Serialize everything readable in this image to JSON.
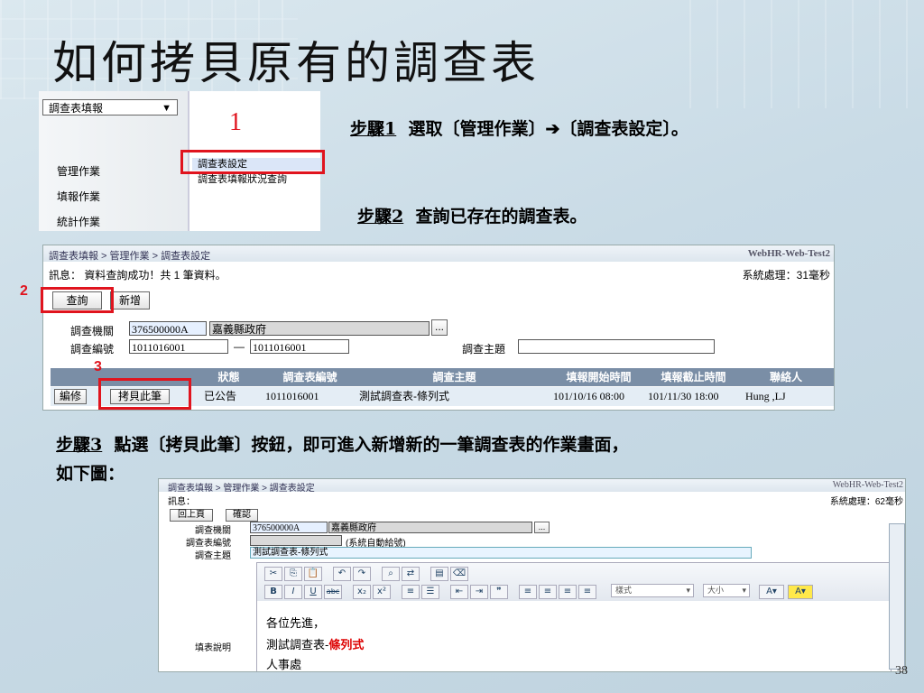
{
  "title": "如何拷貝原有的調查表",
  "menu": {
    "dropdown": "調查表填報",
    "items": [
      "管理作業",
      "填報作業",
      "統計作業"
    ],
    "submenu": [
      "調查表設定",
      "調查表填報狀況查詢"
    ],
    "marker": "1"
  },
  "steps": {
    "s1_label": "步驟1",
    "s1_text": "選取〔管理作業〕➔〔調查表設定〕。",
    "s2_label": "步驟2",
    "s2_text": "查詢已存在的調查表。",
    "s3_label": "步驟3",
    "s3_text": "點選〔拷貝此筆〕按鈕，即可進入新增新的一筆調查表的作業畫面，",
    "s3_text2": "如下圖："
  },
  "query": {
    "breadcrumb": "調查表填報 > 管理作業 > 調查表設定",
    "site": "WebHR-Web-Test2",
    "message": "訊息： 資料查詢成功！共 1 筆資料。",
    "sys": "系統處理：31毫秒",
    "btn_query": "查詢",
    "btn_add": "新增",
    "marker2": "2",
    "marker3": "3",
    "org_label": "調查機關",
    "org_code": "376500000A",
    "org_name": "嘉義縣政府",
    "more": "...",
    "no_label": "調查編號",
    "no_from": "1011016001",
    "dash": "—",
    "no_to": "1011016001",
    "topic_label": "調查主題",
    "headers": [
      "狀態",
      "調查表編號",
      "調查主題",
      "填報開始時間",
      "填報截止時間",
      "聯絡人"
    ],
    "row": {
      "edit": "編修",
      "copy": "拷貝此筆",
      "status": "已公告",
      "no": "1011016001",
      "topic": "測試調查表-條列式",
      "start": "101/10/16 08:00",
      "end": "101/11/30 18:00",
      "contact": "Hung ,LJ"
    }
  },
  "edit": {
    "breadcrumb": "調查表填報 > 管理作業 > 調查表設定",
    "site": "WebHR-Web-Test2",
    "message": "訊息：",
    "sys": "系統處理：62毫秒",
    "btn_back": "回上頁",
    "btn_ok": "確認",
    "org_label": "調查機關",
    "org_code": "376500000A",
    "org_name": "嘉義縣政府",
    "more": "...",
    "no_label": "調查表編號",
    "no_hint": "(系統自動給號)",
    "topic_label": "調查主題",
    "topic": "測試調查表-條列式",
    "desc_label": "填表說明",
    "style_sel": "樣式",
    "size_sel": "大小",
    "body1": "各位先進，",
    "body2a": "測試調查表-",
    "body2b": "條列式",
    "body3": "人事處"
  },
  "page_num": "38"
}
